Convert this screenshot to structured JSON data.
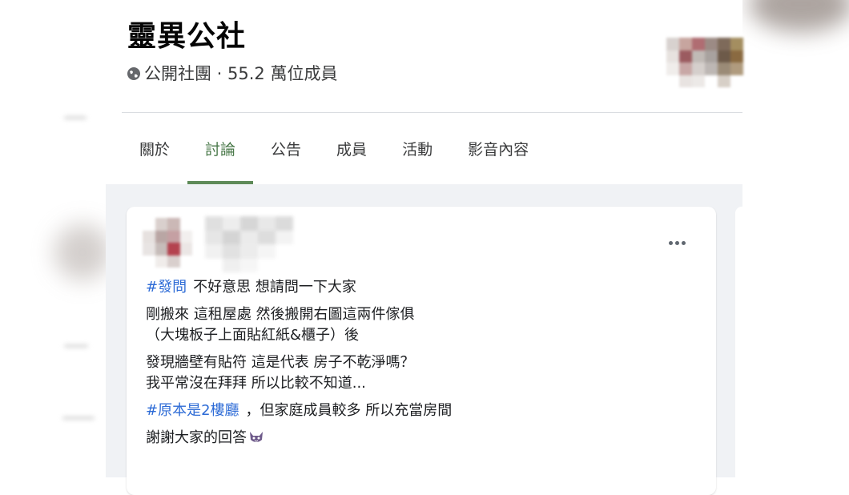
{
  "group": {
    "title": "靈異公社",
    "meta": "公開社團 · 55.2 萬位成員",
    "privacy_icon": "globe-icon"
  },
  "tabs": [
    {
      "label": "關於",
      "active": false
    },
    {
      "label": "討論",
      "active": true
    },
    {
      "label": "公告",
      "active": false
    },
    {
      "label": "成員",
      "active": false
    },
    {
      "label": "活動",
      "active": false
    },
    {
      "label": "影音內容",
      "active": false
    }
  ],
  "post": {
    "menu_icon": "more-options-icon",
    "hashtag1": "#發問",
    "line1": "不好意思 想請問一下大家",
    "line2": "剛搬來 這租屋處 然後搬開右圖這兩件傢俱",
    "line3": "（大塊板子上面貼紅紙&櫃子）後",
    "line4": "發現牆壁有貼符 這是代表 房子不乾淨嗎？",
    "line5": "我平常沒在拜拜 所以比較不知道...",
    "hashtag2": "#原本是2樓廳",
    "line6": "，但家庭成員較多 所以充當房間",
    "line7": "謝謝大家的回答",
    "emoji_icon": "purple-cat-emoji-icon"
  },
  "colors": {
    "active_tab": "#4b7a4b",
    "active_tab_underline": "#5e8a58",
    "hashtag": "#2d6bd6",
    "feed_background": "#f0f2f5"
  }
}
